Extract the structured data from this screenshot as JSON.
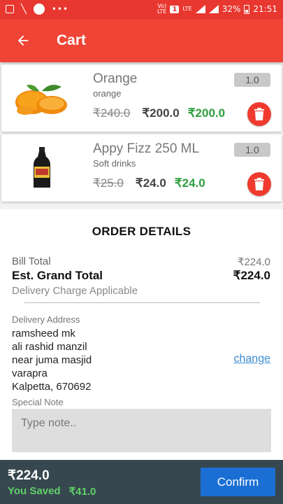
{
  "status_bar": {
    "carrier_1": "Vo)\nLTE",
    "sim_badge": "1",
    "carrier_2": "LTE",
    "battery": "32%",
    "time": "21:51"
  },
  "header": {
    "title": "Cart"
  },
  "cart": {
    "items": [
      {
        "name": "Orange",
        "category": "orange",
        "quantity": "1.0",
        "mrp": "₹240.0",
        "price": "₹200.0",
        "total": "₹200.0",
        "image_icon": "orange-fruit-image"
      },
      {
        "name": "Appy Fizz 250 ML",
        "category": "Soft drinks",
        "quantity": "1.0",
        "mrp": "₹25.0",
        "price": "₹24.0",
        "total": "₹24.0",
        "image_icon": "bottle-image"
      }
    ]
  },
  "order_details": {
    "title": "ORDER DETAILS",
    "bill_total_label": "Bill Total",
    "bill_total_value": "₹224.0",
    "grand_total_label": "Est. Grand Total",
    "grand_total_value": "₹224.0",
    "delivery_note": "Delivery Charge Applicable",
    "address_label": "Delivery Address",
    "address_lines": [
      "ramsheed mk",
      "ali rashid manzil",
      "near juma masjid",
      "varapra",
      "Kalpetta, 670692"
    ],
    "change_label": "change",
    "special_note_label": "Special Note",
    "special_note_placeholder": "Type note..",
    "special_note_value": ""
  },
  "bottom_bar": {
    "total": "₹224.0",
    "saved_label": "You Saved",
    "saved_value": "₹41.0",
    "confirm_label": "Confirm"
  },
  "colors": {
    "status_bar": "#e8372f",
    "app_bar": "#f04436",
    "delete_button": "#f03a2d",
    "price_total": "#2e9e3e",
    "bottom_bar": "#37474f",
    "confirm_button": "#1b6fd4",
    "saved_text": "#5fd068",
    "link": "#3a8bd0"
  }
}
